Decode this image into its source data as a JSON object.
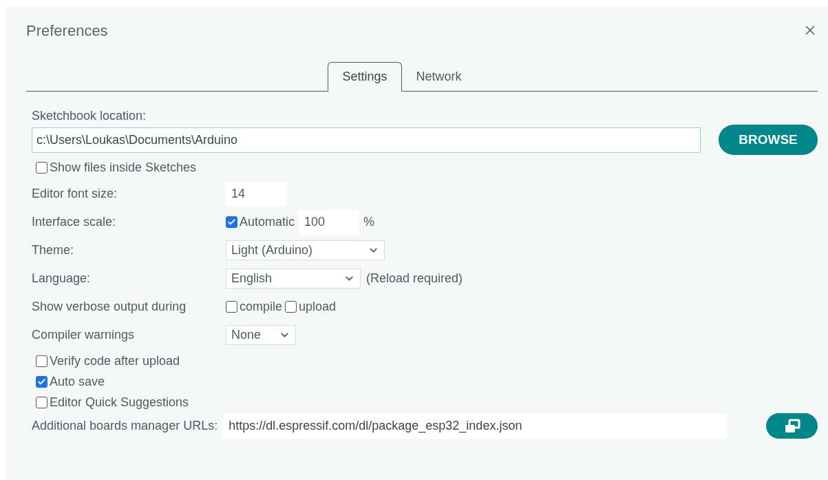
{
  "dialog": {
    "title": "Preferences"
  },
  "tabs": [
    {
      "label": "Settings",
      "selected": true
    },
    {
      "label": "Network",
      "selected": false
    }
  ],
  "sketchbook": {
    "label": "Sketchbook location:",
    "value": "c:\\Users\\Loukas\\Documents\\Arduino",
    "browse": "BROWSE"
  },
  "show_files": {
    "label": "Show files inside Sketches",
    "checked": false
  },
  "rows": [
    {
      "kind": "input",
      "label": "Editor font size:",
      "value": "14"
    },
    {
      "kind": "scale",
      "label": "Interface scale:",
      "check_label": "Automatic",
      "checked": true,
      "value": "100",
      "unit": "%"
    },
    {
      "kind": "select",
      "label": "Theme:",
      "value": "Light (Arduino)"
    },
    {
      "kind": "select",
      "label": "Language:",
      "value": "English",
      "note": "(Reload required)"
    },
    {
      "kind": "checks",
      "label": "Show verbose output during",
      "options": [
        {
          "label": "compile",
          "checked": false
        },
        {
          "label": "upload",
          "checked": false
        }
      ]
    },
    {
      "kind": "select",
      "label": "Compiler warnings",
      "value": "None"
    }
  ],
  "options": [
    {
      "label": "Verify code after upload",
      "checked": false
    },
    {
      "label": "Auto save",
      "checked": true
    },
    {
      "label": "Editor Quick Suggestions",
      "checked": false
    }
  ],
  "urls": {
    "label": "Additional boards manager URLs:",
    "value": "https://dl.espressif.com/dl/package_esp32_index.json"
  }
}
